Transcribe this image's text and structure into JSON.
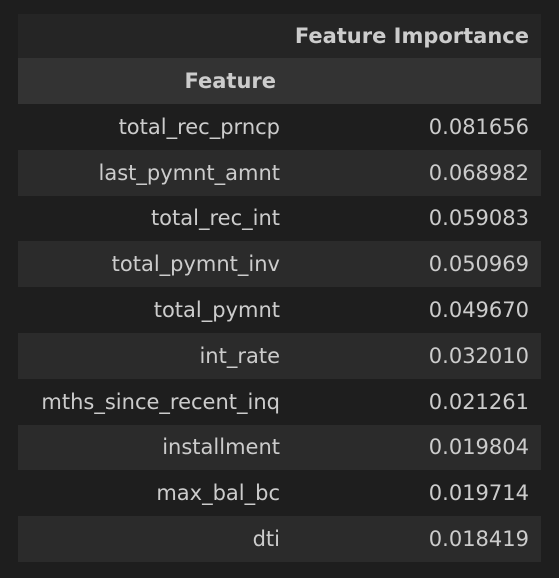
{
  "table": {
    "columns": [
      "Feature Importance"
    ],
    "index_name": "Feature",
    "rows": [
      {
        "feature": "total_rec_prncp",
        "value": "0.081656"
      },
      {
        "feature": "last_pymnt_amnt",
        "value": "0.068982"
      },
      {
        "feature": "total_rec_int",
        "value": "0.059083"
      },
      {
        "feature": "total_pymnt_inv",
        "value": "0.050969"
      },
      {
        "feature": "total_pymnt",
        "value": "0.049670"
      },
      {
        "feature": "int_rate",
        "value": "0.032010"
      },
      {
        "feature": "mths_since_recent_inq",
        "value": "0.021261"
      },
      {
        "feature": "installment",
        "value": "0.019804"
      },
      {
        "feature": "max_bal_bc",
        "value": "0.019714"
      },
      {
        "feature": "dti",
        "value": "0.018419"
      }
    ]
  },
  "colors": {
    "background": "#1e1e1e",
    "header_bg": "#252525",
    "index_header_bg": "#333333",
    "row_even_bg": "#2b2b2b",
    "text": "#cccccc"
  }
}
